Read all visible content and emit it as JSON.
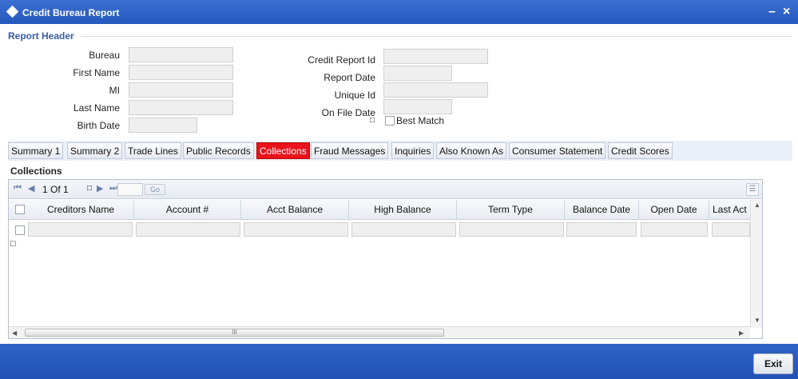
{
  "window": {
    "title": "Credit Bureau Report",
    "minimize_glyph": "–",
    "close_glyph": "×"
  },
  "report_header": {
    "legend": "Report Header",
    "left_fields": [
      {
        "label": "Bureau",
        "value": ""
      },
      {
        "label": "First Name",
        "value": ""
      },
      {
        "label": "MI",
        "value": ""
      },
      {
        "label": "Last Name",
        "value": ""
      },
      {
        "label": "Birth Date",
        "value": ""
      }
    ],
    "right_fields": [
      {
        "label": "Credit Report Id",
        "value": ""
      },
      {
        "label": "Report Date",
        "value": ""
      },
      {
        "label": "Unique Id",
        "value": ""
      },
      {
        "label": "On File Date",
        "value": ""
      }
    ],
    "small_glyph": "□",
    "best_match_label": "Best Match"
  },
  "tabs": [
    {
      "label": "Summary 1",
      "active": false
    },
    {
      "label": "Summary 2",
      "active": false
    },
    {
      "label": "Trade Lines",
      "active": false
    },
    {
      "label": "Public Records",
      "active": false
    },
    {
      "label": "Collections",
      "active": true
    },
    {
      "label": "Fraud Messages",
      "active": false
    },
    {
      "label": "Inquiries",
      "active": false
    },
    {
      "label": "Also Known As",
      "active": false
    },
    {
      "label": "Consumer Statement",
      "active": false
    },
    {
      "label": "Credit Scores",
      "active": false
    }
  ],
  "collections": {
    "section_title": "Collections",
    "pager": {
      "first": "⏮",
      "prev": "◀",
      "text": "1 Of 1",
      "next": "▶",
      "last": "⏭",
      "box_glyph": "□",
      "go_label": "Go"
    },
    "columns": [
      "Creditors Name",
      "Account #",
      "Acct Balance",
      "High Balance",
      "Term Type",
      "Balance Date",
      "Open Date",
      "Last Act"
    ],
    "rows": [
      [
        "",
        "",
        "",
        "",
        "",
        "",
        "",
        ""
      ]
    ],
    "below_rows_glyph": "□",
    "hscroll_grip": "III"
  },
  "footer": {
    "exit_label": "Exit"
  },
  "colors": {
    "title_bar": "#2458bd",
    "active_tab": "#e8131b",
    "accent_text": "#3a5da8"
  }
}
